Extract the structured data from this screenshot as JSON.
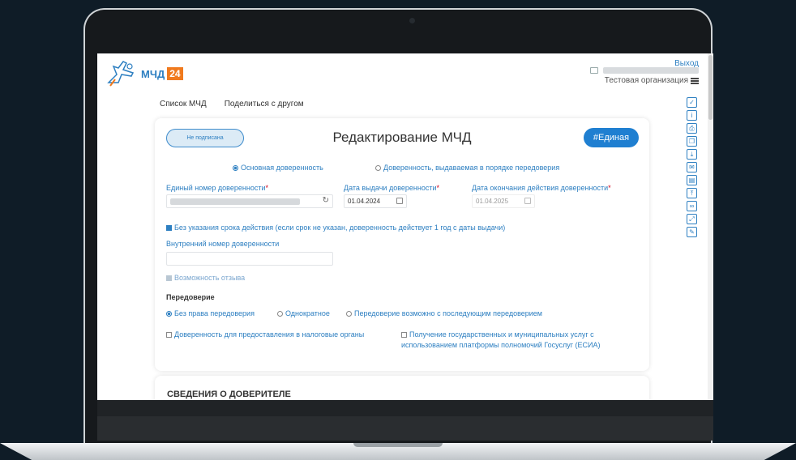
{
  "header": {
    "logo_text": "МЧД",
    "logo_number": "24",
    "exit_label": "Выход",
    "organization": "Тестовая организация"
  },
  "nav": {
    "items": [
      {
        "label": "Список МЧД"
      },
      {
        "label": "Поделиться с другом"
      }
    ]
  },
  "toolbar": {
    "icons": [
      "check-circle-icon",
      "info-icon",
      "print-icon",
      "copy-icon",
      "download-icon",
      "mail-icon",
      "document-icon",
      "upload-icon",
      "link-icon",
      "fullscreen-icon",
      "edit-icon"
    ]
  },
  "form": {
    "status": "Не подписана",
    "title": "Редактирование МЧД",
    "tag": "#Единая",
    "type_options": [
      {
        "label": "Основная доверенность",
        "selected": true
      },
      {
        "label": "Доверенность, выдаваемая в порядке передоверия",
        "selected": false
      }
    ],
    "unified_number_label": "Единый номер доверенности",
    "issue_date_label": "Дата выдачи доверенности",
    "issue_date_value": "01.04.2024",
    "end_date_label": "Дата окончания действия доверенности",
    "end_date_value": "01.04.2025",
    "required_mark": "*",
    "no_term_label": "Без указания срока действия (если срок не указан, доверенность действует 1 год с даты выдачи)",
    "internal_number_label": "Внутренний номер доверенности",
    "internal_number_value": "",
    "revoke_label": "Возможность отзыва",
    "redelegation_title": "Передоверие",
    "redelegation_options": [
      {
        "label": "Без права передоверия",
        "selected": true
      },
      {
        "label": "Однократное",
        "selected": false
      },
      {
        "label": "Передоверие возможно с последующим передоверием",
        "selected": false
      }
    ],
    "tax_label": "Доверенность для предоставления в налоговые органы",
    "gosuslugi_label_1": "Получение государственных и муниципальных услуг с",
    "gosuslugi_label_2": "использованием платформы полномочий Госуслуг (ЕСИА)"
  },
  "principal_section": {
    "title": "СВЕДЕНИЯ О ДОВЕРИТЕЛЕ"
  }
}
